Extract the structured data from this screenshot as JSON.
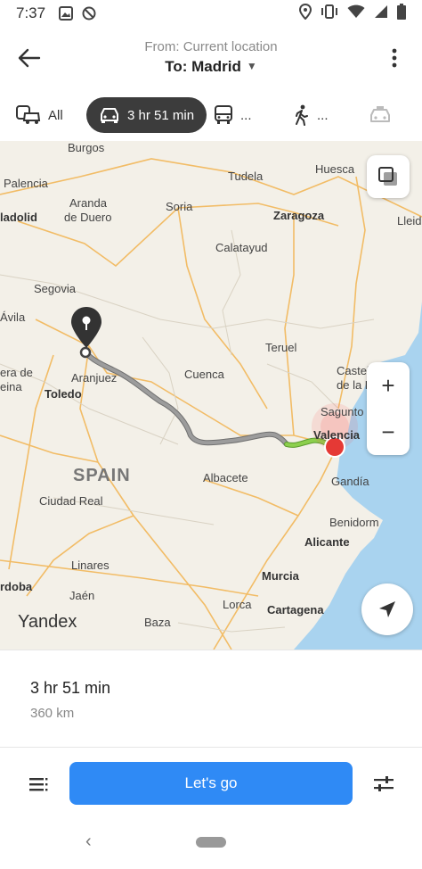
{
  "status_bar": {
    "time": "7:37",
    "icons_left": [
      "photo-notification-icon",
      "blocked-notification-icon"
    ],
    "icons_right": [
      "location-icon",
      "vibrate-icon",
      "wifi-icon",
      "signal-icon",
      "battery-icon"
    ]
  },
  "header": {
    "from_label": "From: Current location",
    "to_label": "To: Madrid",
    "to_caret": "▼"
  },
  "tabs": [
    {
      "label": "All",
      "icon": "all-transport-icon",
      "active": false
    },
    {
      "label": "3 hr 51 min",
      "icon": "car-icon",
      "active": true
    },
    {
      "label": "...",
      "icon": "bus-icon",
      "active": false
    },
    {
      "label": "...",
      "icon": "walk-icon",
      "active": false
    },
    {
      "label": "",
      "icon": "taxi-icon",
      "active": false
    }
  ],
  "map": {
    "country_label": "SPAIN",
    "brand": "Yandex",
    "cities": [
      "Burgos",
      "Palencia",
      "Tudela",
      "Huesca",
      "Aranda",
      "de Duero",
      "Soria",
      "Zaragoza",
      "Lleid",
      "ladolid",
      "Calatayud",
      "Segovia",
      "Ávila",
      "Teruel",
      "Castellón",
      "de la P",
      "era de",
      "eina",
      "Aranjuez",
      "Toledo",
      "Cuenca",
      "Sagunto",
      "Valencia",
      "Albacete",
      "Gandía",
      "Ciudad Real",
      "Benidorm",
      "Alicante",
      "Linares",
      "Murcia",
      "rdoba",
      "Jaén",
      "Lorca",
      "Cartagena",
      "Baza"
    ],
    "route_colors": {
      "congested": "#8a8a8a",
      "free": "#7ac143",
      "end": "#e53935"
    },
    "zoom_in": "+",
    "zoom_out": "−"
  },
  "summary": {
    "duration": "3 hr 51 min",
    "distance": "360 km"
  },
  "actions": {
    "go_label": "Let's go",
    "go_color": "#2f8af5"
  },
  "nav": {
    "back": "‹"
  }
}
